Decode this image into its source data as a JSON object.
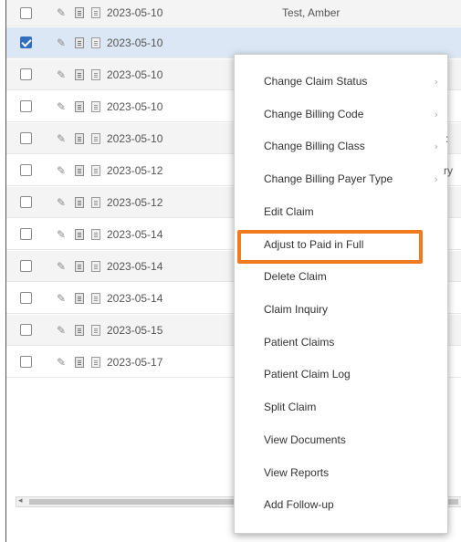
{
  "rows": [
    {
      "checked": false,
      "date": "2023-05-10",
      "name": "Test, Amber"
    },
    {
      "checked": true,
      "date": "2023-05-10",
      "name": ""
    },
    {
      "checked": false,
      "date": "2023-05-10",
      "name": ""
    },
    {
      "checked": false,
      "date": "2023-05-10",
      "name": ""
    },
    {
      "checked": false,
      "date": "2023-05-10",
      "name": ""
    },
    {
      "checked": false,
      "date": "2023-05-12",
      "name": ""
    },
    {
      "checked": false,
      "date": "2023-05-12",
      "name": ""
    },
    {
      "checked": false,
      "date": "2023-05-14",
      "name": ""
    },
    {
      "checked": false,
      "date": "2023-05-14",
      "name": ""
    },
    {
      "checked": false,
      "date": "2023-05-14",
      "name": ""
    },
    {
      "checked": false,
      "date": "2023-05-15",
      "name": ""
    },
    {
      "checked": false,
      "date": "2023-05-17",
      "name": ""
    }
  ],
  "peek_texts": {
    "row4_right": ":",
    "row5_right": "ry"
  },
  "context_menu": {
    "items": [
      {
        "label": "Change Claim Status",
        "submenu": true
      },
      {
        "label": "Change Billing Code",
        "submenu": true
      },
      {
        "label": "Change Billing Class",
        "submenu": true
      },
      {
        "label": "Change Billing Payer Type",
        "submenu": true
      },
      {
        "label": "Edit Claim",
        "submenu": false
      },
      {
        "label": "Adjust to Paid in Full",
        "submenu": false,
        "highlighted": true
      },
      {
        "label": "Delete Claim",
        "submenu": false
      },
      {
        "label": "Claim Inquiry",
        "submenu": false
      },
      {
        "label": "Patient Claims",
        "submenu": false
      },
      {
        "label": "Patient Claim Log",
        "submenu": false
      },
      {
        "label": "Split Claim",
        "submenu": false
      },
      {
        "label": "View Documents",
        "submenu": false
      },
      {
        "label": "View Reports",
        "submenu": false
      },
      {
        "label": "Add Follow-up",
        "submenu": false
      }
    ],
    "chevron": "›"
  },
  "colors": {
    "highlight_border": "#f07b1f",
    "selected_row": "#dbe7f5",
    "checkbox_checked": "#2f6ec0"
  },
  "icons": {
    "edit": "pencil-icon",
    "claim_doc": "claim-document-icon",
    "note_doc": "note-document-icon",
    "scroll_left": "◂"
  }
}
